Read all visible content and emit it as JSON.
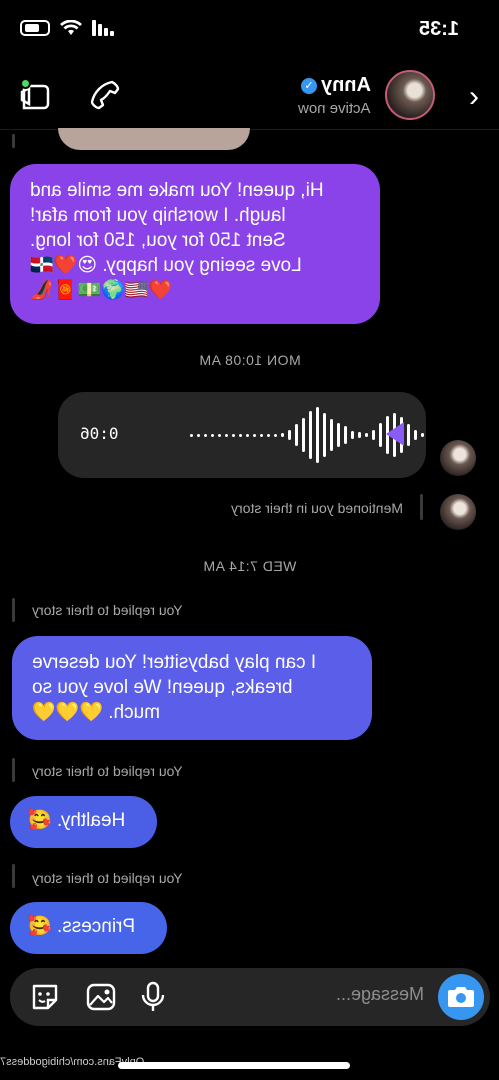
{
  "status_bar": {
    "time": "1:35"
  },
  "header": {
    "name": "Anny",
    "verified_icon": "verified-badge-icon",
    "status": "Active now",
    "icons": [
      "back-chevron-icon",
      "phone-icon",
      "video-camera-icon"
    ]
  },
  "messages": {
    "msg1": "Hi, queen! You make me smile and\nlaugh. I worship you from afar!\nSent 150 for you, 150 for long.\nLove seeing you happy. 😍❤️🇩🇴\n❤️🇺🇸🌍💵🧧👠",
    "ts1": "MON 10:08 AM",
    "voice_duration": "0:06",
    "mention_note": "Mentioned you in their story",
    "ts2": "WED 7:14 AM",
    "reply_note_1": "You replied to their story",
    "msg2": "I can play babysitter! You deserve\nbreaks, queen! We love you so\nmuch. 💛💛💛",
    "reply_note_2": "You replied to their story",
    "msg3": "Healthy. 🥰",
    "reply_note_3": "You replied to their story",
    "msg4": "Princess. 🥰"
  },
  "composer": {
    "placeholder": "Message...",
    "icons": [
      "camera-icon",
      "microphone-icon",
      "gallery-icon",
      "sticker-icon"
    ]
  },
  "watermark": "OnlyFans.com/chibigoddess7",
  "colors": {
    "purple_bubble": "#8a43e8",
    "blue_bubble": "#5b5ee8",
    "accent": "#3797f0"
  }
}
